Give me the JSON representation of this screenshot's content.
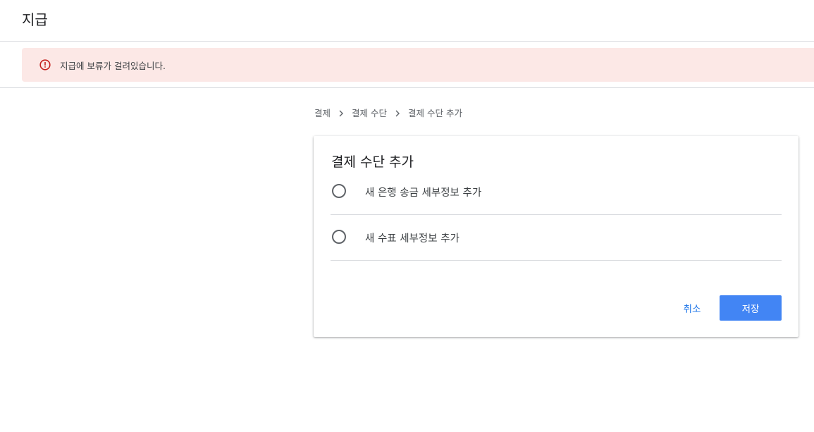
{
  "header": {
    "title": "지급"
  },
  "alert": {
    "icon": "error-outline-icon",
    "text": "지급에 보류가 걸려있습니다.",
    "color": "#c5221f",
    "background": "#fce8e6"
  },
  "breadcrumb": {
    "items": [
      "결제",
      "결제 수단",
      "결제 수단 추가"
    ],
    "separator_icon": "chevron-right-icon"
  },
  "card": {
    "title": "결제 수단 추가",
    "options": [
      {
        "label": "새 은행 송금 세부정보 추가",
        "selected": false
      },
      {
        "label": "새 수표 세부정보 추가",
        "selected": false
      }
    ],
    "cancel_label": "취소",
    "save_label": "저장",
    "accent_color": "#4285f4"
  }
}
